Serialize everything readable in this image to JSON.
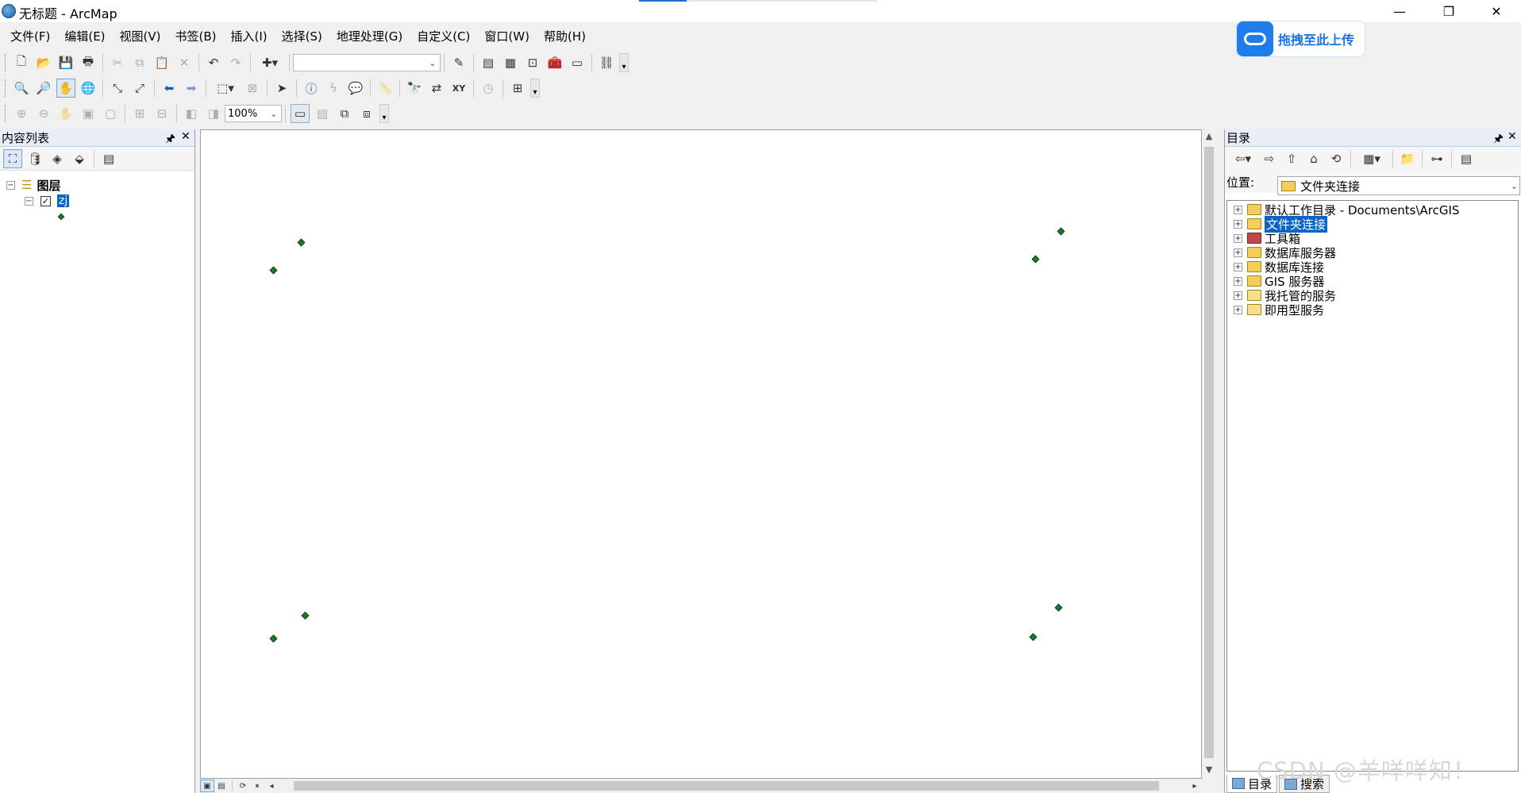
{
  "window": {
    "title": "无标题 - ArcMap"
  },
  "menu": [
    "文件(F)",
    "编辑(E)",
    "视图(V)",
    "书签(B)",
    "插入(I)",
    "选择(S)",
    "地理处理(G)",
    "自定义(C)",
    "窗口(W)",
    "帮助(H)"
  ],
  "upload": {
    "label": "拖拽至此上传"
  },
  "toolbar": {
    "scale_value": "",
    "zoom_value": "100%"
  },
  "toc": {
    "title": "内容列表",
    "group_label": "图层",
    "layer_name": "zj",
    "layer_checked": "✓"
  },
  "catalog": {
    "title": "目录",
    "location_label": "位置:",
    "location_value": "文件夹连接",
    "items": [
      {
        "label": "默认工作目录 - Documents\\ArcGIS"
      },
      {
        "label": "文件夹连接"
      },
      {
        "label": "工具箱"
      },
      {
        "label": "数据库服务器"
      },
      {
        "label": "数据库连接"
      },
      {
        "label": "GIS 服务器"
      },
      {
        "label": "我托管的服务"
      },
      {
        "label": "即用型服务"
      }
    ],
    "selected_index": 1,
    "tabs": [
      "目录",
      "搜索"
    ]
  },
  "watermark": "CSDN @羊咩咩知！",
  "colors": {
    "point": "#1a7a2e",
    "selection": "#0a64c8",
    "upload_accent": "#1e7de8"
  }
}
